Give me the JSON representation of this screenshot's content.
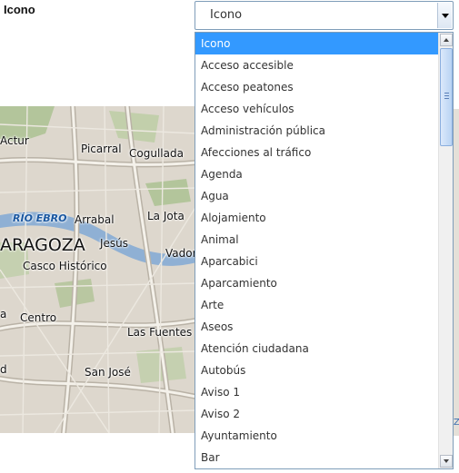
{
  "field": {
    "label": "Icono"
  },
  "select": {
    "value": "Icono"
  },
  "options": [
    "Icono",
    "Acceso accesible",
    "Acceso peatones",
    "Acceso vehículos",
    "Administración pública",
    "Afecciones al tráfico",
    "Agenda",
    "Agua",
    "Alojamiento",
    "Animal",
    "Aparcabici",
    "Aparcamiento",
    "Arte",
    "Aseos",
    "Atención ciudadana",
    "Autobús",
    "Aviso 1",
    "Aviso 2",
    "Ayuntamiento",
    "Bar"
  ],
  "selected_index": 0,
  "map": {
    "labels": {
      "actur": "Actur",
      "picarral": "Picarral",
      "cogullada": "Cogullada",
      "rio_ebro": "RÍO EBRO",
      "arrabal": "Arrabal",
      "la_jota": "La Jota",
      "zaragoza": "ARAGOZA",
      "jesus": "Jesús",
      "vadorrey": "Vador",
      "casco_historico": "Casco Histórico",
      "a": "a",
      "centro": "Centro",
      "las_fuentes": "Las Fuentes",
      "d": "d",
      "san_jose": "San José"
    },
    "edge_letter": "Z"
  },
  "colors": {
    "selected_bg": "#3399ff",
    "border": "#7f9db9",
    "river": "#8fb0d4",
    "park": "#a9c18e"
  }
}
